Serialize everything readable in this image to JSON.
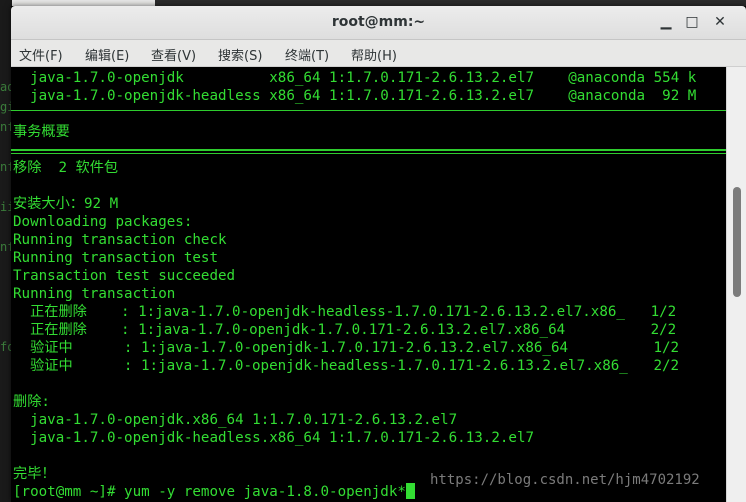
{
  "window": {
    "title": "root@mm:~",
    "minimize_glyph": "▁",
    "maximize_glyph": "□",
    "close_glyph": "✕"
  },
  "menu": [
    "文件(F)",
    "编辑(E)",
    "查看(V)",
    "搜索(S)",
    "终端(T)",
    "帮助(H)"
  ],
  "terminal_lines": {
    "l1": "  java-1.7.0-openjdk          x86_64 1:1.7.0.171-2.6.13.2.el7    @anaconda 554 k",
    "l2": "  java-1.7.0-openjdk-headless x86_64 1:1.7.0.171-2.6.13.2.el7    @anaconda  92 M",
    "l3": "事务概要",
    "l4": "移除  2 软件包",
    "l5": "安装大小：92 M",
    "l6": "Downloading packages:",
    "l7": "Running transaction check",
    "l8": "Running transaction test",
    "l9": "Transaction test succeeded",
    "l10": "Running transaction",
    "l11": "  正在删除    : 1:java-1.7.0-openjdk-headless-1.7.0.171-2.6.13.2.el7.x86_   1/2",
    "l12": "  正在删除    : 1:java-1.7.0-openjdk-1.7.0.171-2.6.13.2.el7.x86_64          2/2",
    "l13": "  验证中      : 1:java-1.7.0-openjdk-1.7.0.171-2.6.13.2.el7.x86_64          1/2",
    "l14": "  验证中      : 1:java-1.7.0-openjdk-headless-1.7.0.171-2.6.13.2.el7.x86_   2/2",
    "l15": "删除:",
    "l16": "  java-1.7.0-openjdk.x86_64 1:1.7.0.171-2.6.13.2.el7",
    "l17": "  java-1.7.0-openjdk-headless.x86_64 1:1.7.0.171-2.6.13.2.el7",
    "l18": "完毕！",
    "prompt": "[root@mm ~]# yum -y remove java-1.8.0-openjdk*"
  },
  "watermark": "https://blog.csdn.net/hjm4702192",
  "colors": {
    "terminal_fg": "#33dd33",
    "terminal_bg": "#000000",
    "titlebar": "#e4e4e4"
  }
}
